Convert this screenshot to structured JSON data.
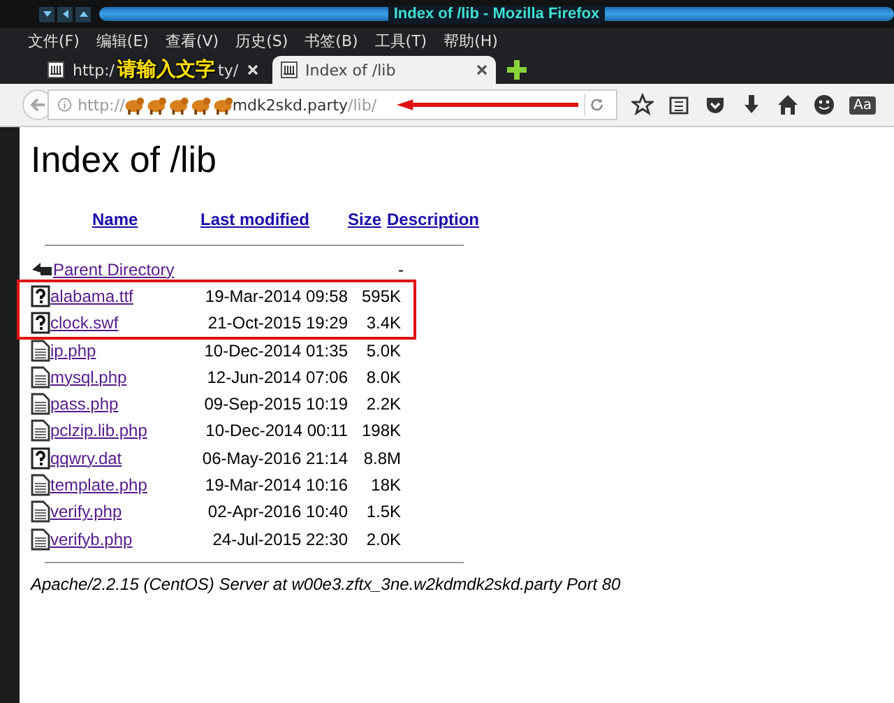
{
  "window": {
    "title": "Index of /lib - Mozilla Firefox"
  },
  "menu": [
    "文件(F)",
    "编辑(E)",
    "查看(V)",
    "历史(S)",
    "书签(B)",
    "工具(T)",
    "帮助(H)"
  ],
  "tabs": [
    {
      "label": "http:/",
      "label_end": "ty/",
      "selected": false
    },
    {
      "label": "Index of /lib",
      "selected": true
    }
  ],
  "annotation": {
    "text": "请输入文字"
  },
  "address": {
    "prefix": "http://",
    "host_end": "mdk2skd.party",
    "path": "/lib/"
  },
  "toolbar_text": "Aa",
  "page": {
    "heading": "Index of /lib",
    "columns": [
      "Name",
      "Last modified",
      "Size",
      "Description"
    ],
    "rows": [
      {
        "kind": "parent",
        "name": "Parent Directory",
        "modified": "",
        "size": "-",
        "highlighted": false
      },
      {
        "kind": "unknown",
        "name": "alabama.ttf",
        "modified": "19-Mar-2014 09:58",
        "size": "595K",
        "highlighted": true
      },
      {
        "kind": "unknown",
        "name": "clock.swf",
        "modified": "21-Oct-2015 19:29",
        "size": "3.4K",
        "highlighted": true
      },
      {
        "kind": "text",
        "name": "ip.php",
        "modified": "10-Dec-2014 01:35",
        "size": "5.0K",
        "highlighted": false
      },
      {
        "kind": "text",
        "name": "mysql.php",
        "modified": "12-Jun-2014 07:06",
        "size": "8.0K",
        "highlighted": false
      },
      {
        "kind": "text",
        "name": "pass.php",
        "modified": "09-Sep-2015 10:19",
        "size": "2.2K",
        "highlighted": false
      },
      {
        "kind": "text",
        "name": "pclzip.lib.php",
        "modified": "10-Dec-2014 00:11",
        "size": "198K",
        "highlighted": false
      },
      {
        "kind": "unknown",
        "name": "qqwry.dat",
        "modified": "06-May-2016 21:14",
        "size": "8.8M",
        "highlighted": false
      },
      {
        "kind": "text",
        "name": "template.php",
        "modified": "19-Mar-2014 10:16",
        "size": "18K",
        "highlighted": false
      },
      {
        "kind": "text",
        "name": "verify.php",
        "modified": "02-Apr-2016 10:40",
        "size": "1.5K",
        "highlighted": false
      },
      {
        "kind": "text",
        "name": "verifyb.php",
        "modified": "24-Jul-2015 22:30",
        "size": "2.0K",
        "highlighted": false
      }
    ],
    "footer": "Apache/2.2.15 (CentOS) Server at w00e3.zftx_3ne.w2kdmdk2skd.party Port 80"
  }
}
